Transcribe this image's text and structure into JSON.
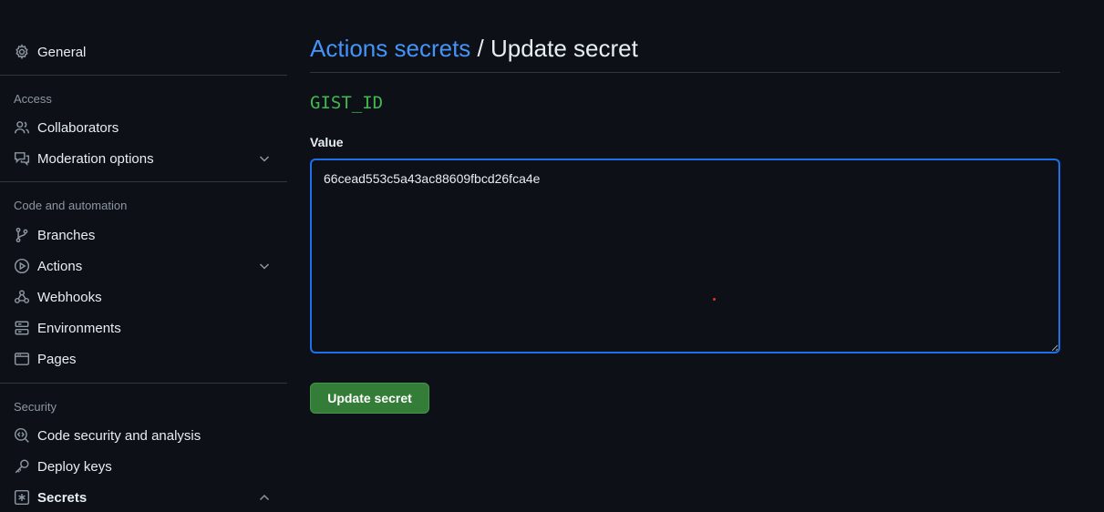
{
  "sidebar": {
    "general": {
      "label": "General",
      "icon": "gear-icon"
    },
    "sections": {
      "access": {
        "title": "Access"
      },
      "code_automation": {
        "title": "Code and automation"
      },
      "security": {
        "title": "Security"
      }
    },
    "items": {
      "collaborators": {
        "label": "Collaborators",
        "icon": "people-icon"
      },
      "moderation": {
        "label": "Moderation options",
        "icon": "comment-discussion-icon"
      },
      "branches": {
        "label": "Branches",
        "icon": "git-branch-icon"
      },
      "actions": {
        "label": "Actions",
        "icon": "play-icon"
      },
      "webhooks": {
        "label": "Webhooks",
        "icon": "webhook-icon"
      },
      "environments": {
        "label": "Environments",
        "icon": "server-icon"
      },
      "pages": {
        "label": "Pages",
        "icon": "browser-icon"
      },
      "code_security": {
        "label": "Code security and analysis",
        "icon": "codescan-icon"
      },
      "deploy_keys": {
        "label": "Deploy keys",
        "icon": "key-icon"
      },
      "secrets": {
        "label": "Secrets",
        "icon": "asterisk-icon"
      }
    }
  },
  "main": {
    "breadcrumb_link": "Actions secrets",
    "breadcrumb_sep": " / ",
    "breadcrumb_current": "Update secret",
    "secret_name": "GIST_ID",
    "value_label": "Value",
    "value": "66cead553c5a43ac88609fbcd26fca4e",
    "submit_label": "Update secret"
  },
  "colors": {
    "background": "#0d1117",
    "link": "#4493f8",
    "secret_name": "#3fb950",
    "button": "#347d39",
    "focus_border": "#1f6feb"
  }
}
